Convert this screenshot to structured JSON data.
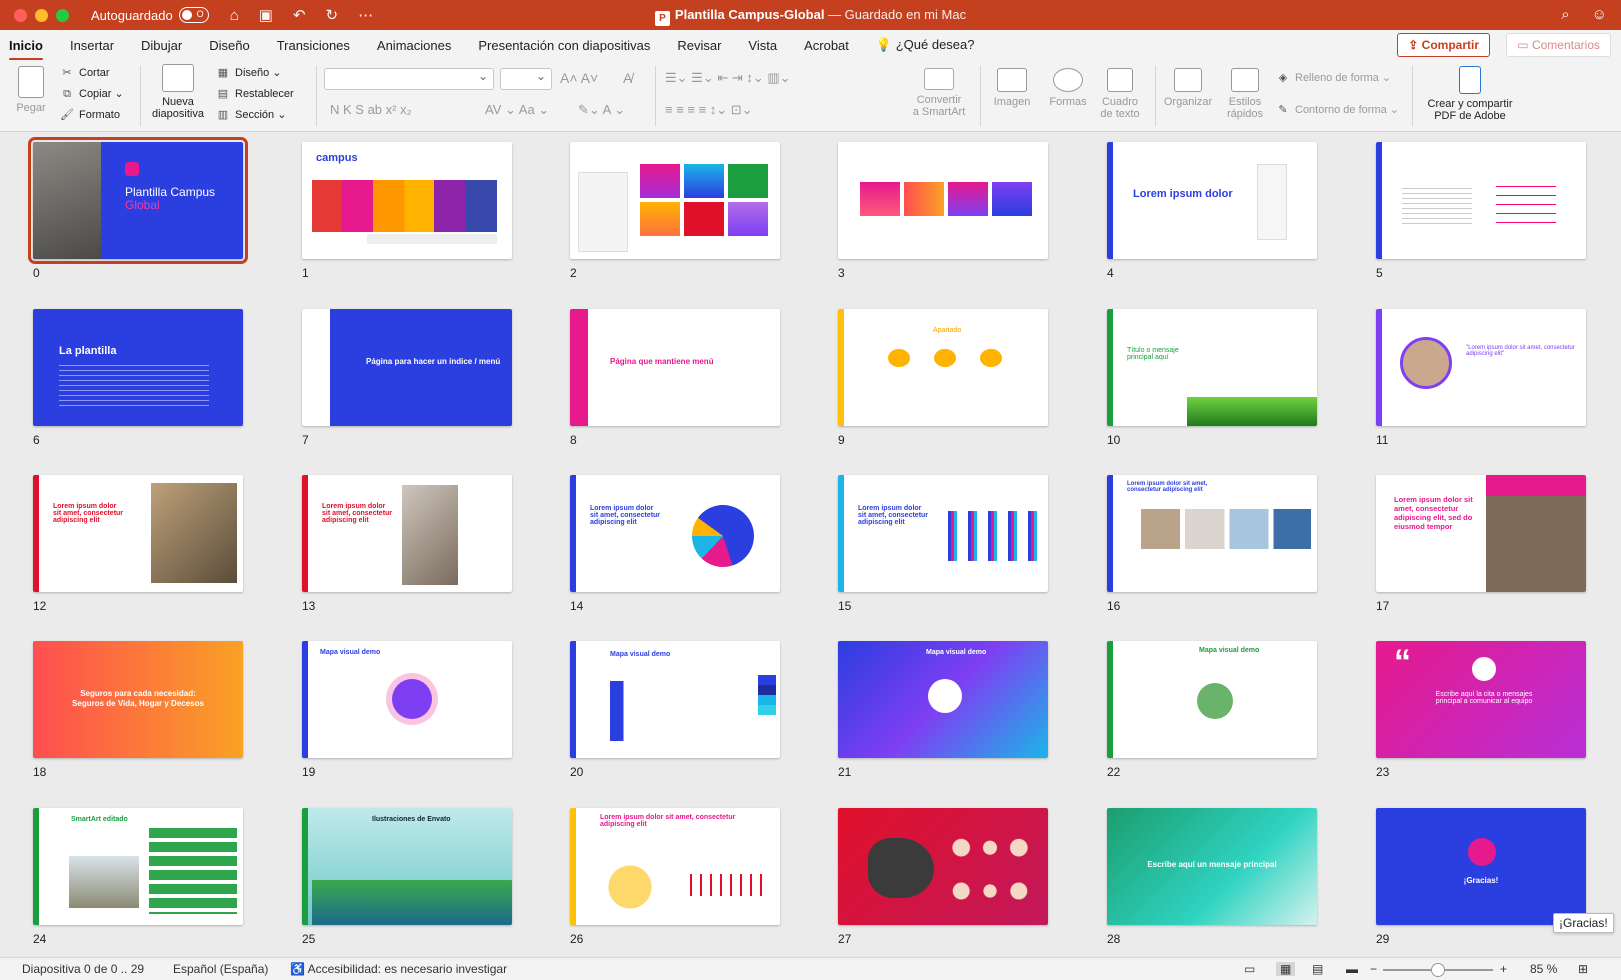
{
  "titlebar": {
    "autosave_label": "Autoguardado",
    "toggle_state": "O",
    "doc_title": "Plantilla Campus-Global",
    "doc_status": "— Guardado en mi Mac",
    "app_badge": "P"
  },
  "tabs": [
    {
      "label": "Inicio",
      "active": true
    },
    {
      "label": "Insertar"
    },
    {
      "label": "Dibujar"
    },
    {
      "label": "Diseño"
    },
    {
      "label": "Transiciones"
    },
    {
      "label": "Animaciones"
    },
    {
      "label": "Presentación con diapositivas"
    },
    {
      "label": "Revisar"
    },
    {
      "label": "Vista"
    },
    {
      "label": "Acrobat"
    },
    {
      "label": "¿Qué desea?"
    }
  ],
  "share_label": "Compartir",
  "comments_label": "Comentarios",
  "ribbon": {
    "paste": "Pegar",
    "cut": "Cortar",
    "copy": "Copiar",
    "format": "Formato",
    "new_slide_1": "Nueva",
    "new_slide_2": "diapositiva",
    "layout": "Diseño",
    "reset": "Restablecer",
    "section": "Sección",
    "font_sample": "N   K   S   ab   x²   x₂",
    "convert_1": "Convertir",
    "convert_2": "a SmartArt",
    "image": "Imagen",
    "shapes": "Formas",
    "textbox_1": "Cuadro",
    "textbox_2": "de texto",
    "arrange": "Organizar",
    "styles_1": "Estilos",
    "styles_2": "rápidos",
    "fill": "Relleno de forma",
    "outline": "Contorno de forma",
    "pdf_1": "Crear y compartir",
    "pdf_2": "PDF de Adobe"
  },
  "slides": [
    {
      "n": "0",
      "title": "Plantilla Campus",
      "title2": "Global"
    },
    {
      "n": "1",
      "title": "campus"
    },
    {
      "n": "2",
      "title": ""
    },
    {
      "n": "3",
      "title": ""
    },
    {
      "n": "4",
      "title": "Lorem ipsum dolor"
    },
    {
      "n": "5",
      "title": ""
    },
    {
      "n": "6",
      "title": "La plantilla"
    },
    {
      "n": "7",
      "title": "Página para hacer un índice / menú"
    },
    {
      "n": "8",
      "title": "Página que mantiene menú"
    },
    {
      "n": "9",
      "title": "Apartado"
    },
    {
      "n": "10",
      "title": "Título o mensaje principal aquí"
    },
    {
      "n": "11",
      "title": "\"Lorem ipsum dolor sit amet, consectetur adipiscing elit\""
    },
    {
      "n": "12",
      "title": "Lorem ipsum dolor sit amet, consectetur adipiscing elit"
    },
    {
      "n": "13",
      "title": "Lorem ipsum dolor sit amet, consectetur adipiscing elit"
    },
    {
      "n": "14",
      "title": "Lorem ipsum dolor sit amet, consectetur adipiscing elit"
    },
    {
      "n": "15",
      "title": "Lorem ipsum dolor sit amet, consectetur adipiscing elit"
    },
    {
      "n": "16",
      "title": "Lorem ipsum dolor sit amet, consectetur adipiscing elit"
    },
    {
      "n": "17",
      "title": "Lorem ipsum dolor sit amet, consectetur adipiscing elit, sed do eiusmod tempor"
    },
    {
      "n": "18",
      "title": "Seguros para cada necesidad:",
      "title2": "Seguros de Vida, Hogar y Decesos"
    },
    {
      "n": "19",
      "title": "Mapa visual demo"
    },
    {
      "n": "20",
      "title": "Mapa visual demo"
    },
    {
      "n": "21",
      "title": "Mapa visual demo"
    },
    {
      "n": "22",
      "title": "Mapa visual demo"
    },
    {
      "n": "23",
      "title": "Escribe aquí la cita o mensajes principal a comunicar al equipo"
    },
    {
      "n": "24",
      "title": "SmartArt editado"
    },
    {
      "n": "25",
      "title": "Ilustraciones de Envato"
    },
    {
      "n": "26",
      "title": "Lorem ipsum dolor sit amet, consectetur adipiscing elit"
    },
    {
      "n": "27",
      "title": ""
    },
    {
      "n": "28",
      "title": "Escribe aquí un mensaje principal"
    },
    {
      "n": "29",
      "title": "¡Gracias!"
    }
  ],
  "statusbar": {
    "slide_info": "Diapositiva 0 de 0 .. 29",
    "language": "Español (España)",
    "accessibility": "Accesibilidad: es necesario investigar",
    "zoom": "85 %"
  },
  "tooltip": "¡Gracias!",
  "colors": {
    "accent": "#c5401f",
    "blue": "#2b3ee0",
    "pink": "#e6198d"
  }
}
